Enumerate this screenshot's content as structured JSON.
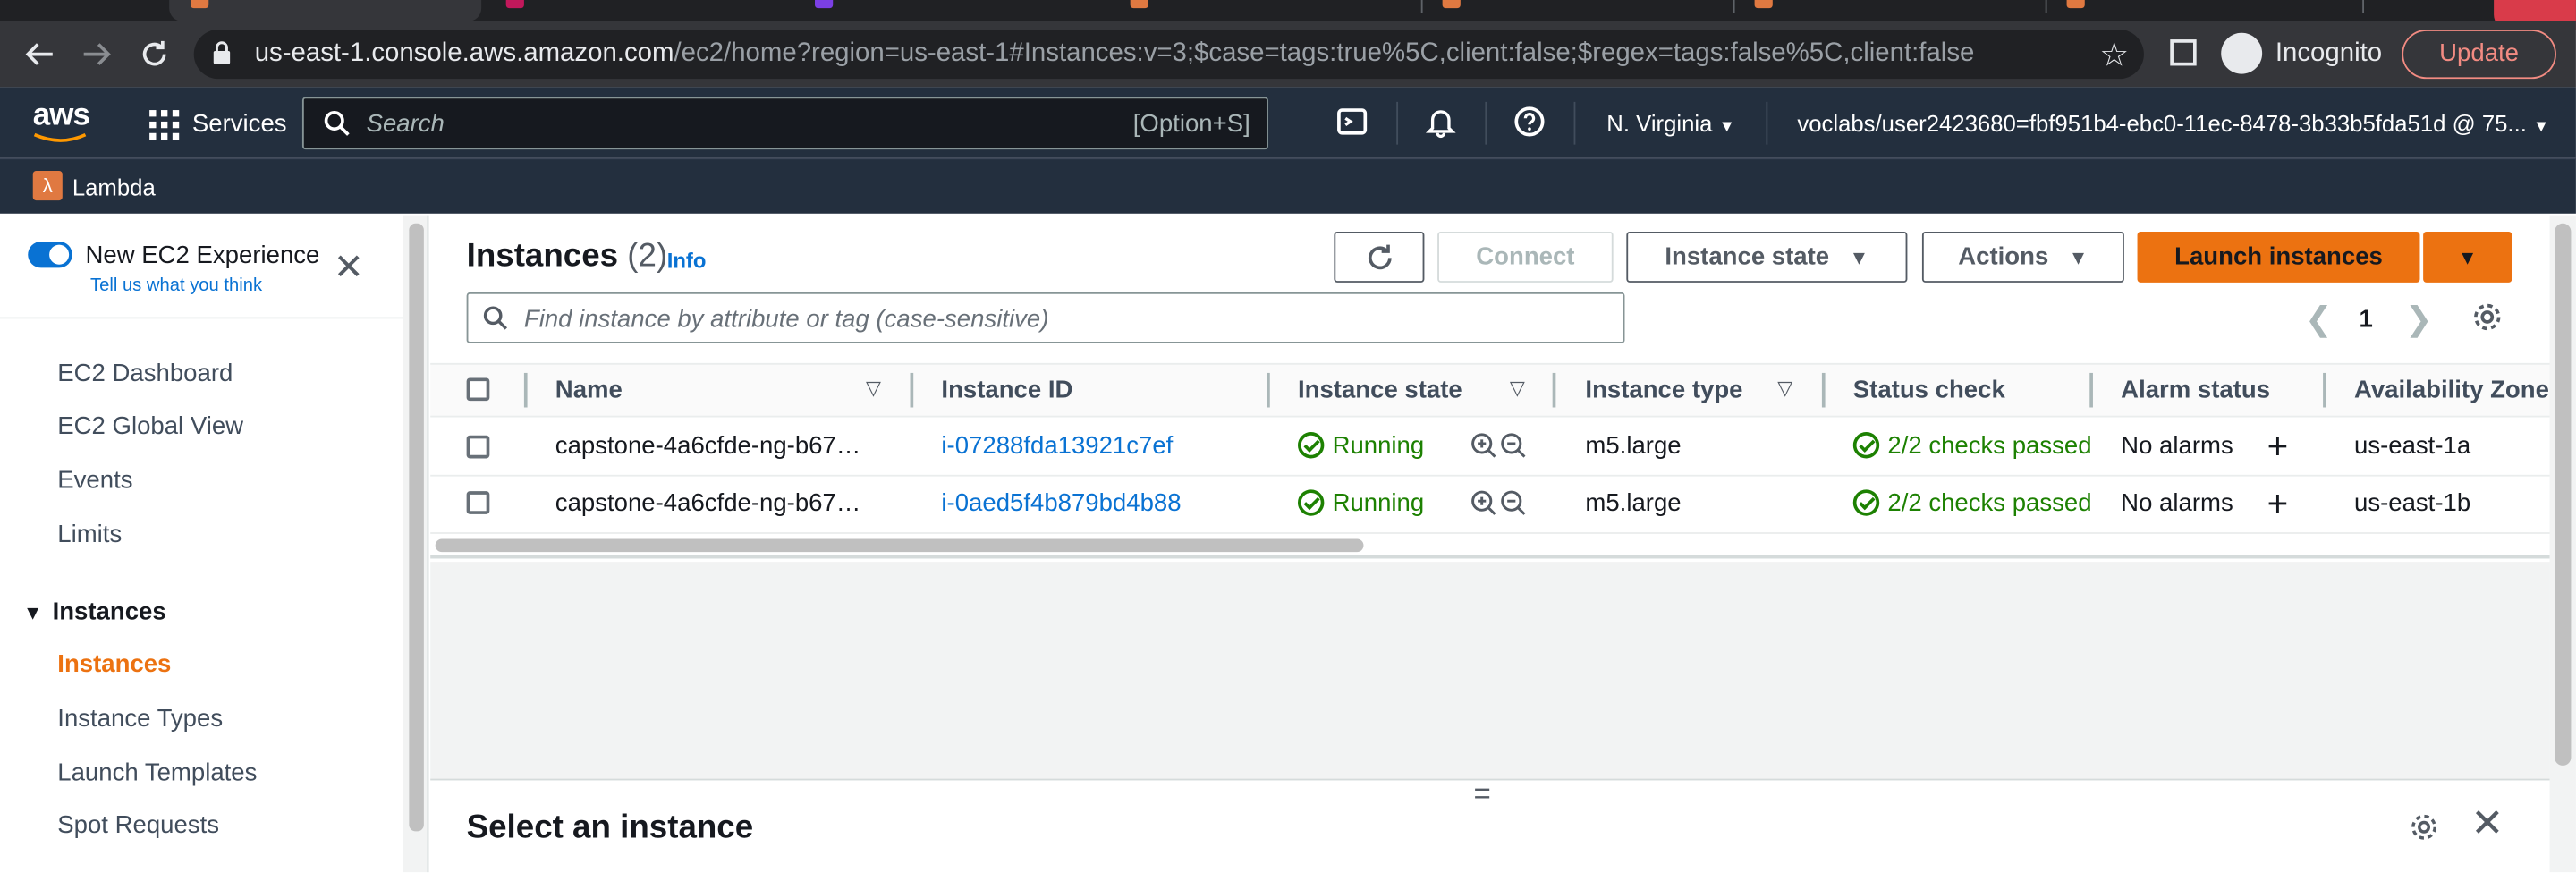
{
  "browser": {
    "url_host": "us-east-1.console.aws.amazon.com",
    "url_path": "/ec2/home?region=us-east-1#Instances:v=3;$case=tags:true%5C,client:false;$regex=tags:false%5C,client:false",
    "incognito_label": "Incognito",
    "update_label": "Update"
  },
  "aws_nav": {
    "logo": "aws",
    "services_label": "Services",
    "search_placeholder": "Search",
    "search_shortcut": "[Option+S]",
    "region": "N. Virginia",
    "account": "voclabs/user2423680=fbf951b4-ebc0-11ec-8478-3b33b5fda51d @ 75...",
    "favorite": "Lambda"
  },
  "sidebar": {
    "new_experience_label": "New EC2 Experience",
    "tell_us": "Tell us what you think",
    "items": [
      "EC2 Dashboard",
      "EC2 Global View",
      "Events",
      "Limits"
    ],
    "section_label": "Instances",
    "section_items": [
      "Instances",
      "Instance Types",
      "Launch Templates",
      "Spot Requests"
    ]
  },
  "main": {
    "title": "Instances",
    "count": "(2)",
    "info": "Info",
    "buttons": {
      "connect": "Connect",
      "instance_state": "Instance state",
      "actions": "Actions",
      "launch": "Launch instances"
    },
    "filter_placeholder": "Find instance by attribute or tag (case-sensitive)",
    "page": "1",
    "columns": [
      "Name",
      "Instance ID",
      "Instance state",
      "Instance type",
      "Status check",
      "Alarm status",
      "Availability Zone"
    ],
    "rows": [
      {
        "name": "capstone-4a6cfde-ng-b67…",
        "id": "i-07288fda13921c7ef",
        "state": "Running",
        "type": "m5.large",
        "status": "2/2 checks passed",
        "alarm": "No alarms",
        "az": "us-east-1a"
      },
      {
        "name": "capstone-4a6cfde-ng-b67…",
        "id": "i-0aed5f4b879bd4b88",
        "state": "Running",
        "type": "m5.large",
        "status": "2/2 checks passed",
        "alarm": "No alarms",
        "az": "us-east-1b"
      }
    ],
    "split_panel_title": "Select an instance"
  },
  "colors": {
    "aws_nav": "#232f3e",
    "accent_orange": "#ec7211",
    "link_blue": "#0972d3",
    "success_green": "#1d8102"
  }
}
